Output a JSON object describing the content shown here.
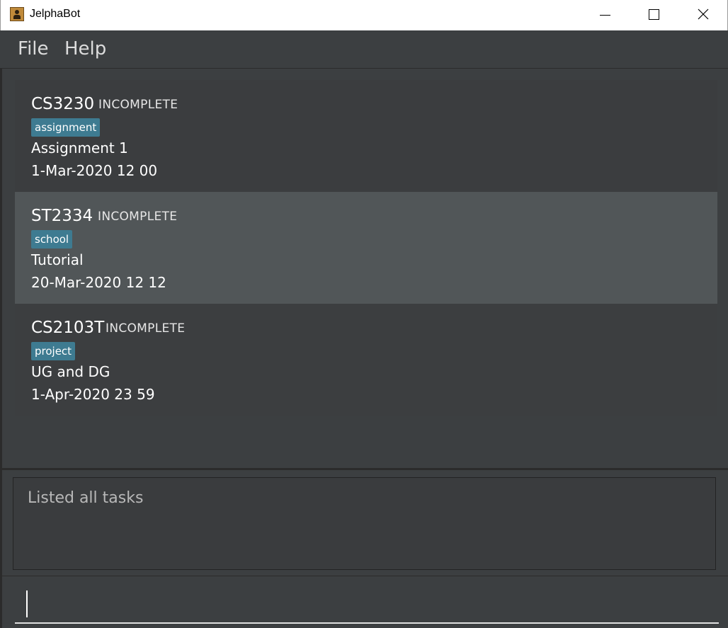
{
  "window": {
    "title": "JelphaBot",
    "controls": [
      "minimize-icon",
      "maximize-icon",
      "close-icon"
    ]
  },
  "menu": {
    "items": [
      {
        "label": "File"
      },
      {
        "label": "Help"
      }
    ]
  },
  "tasks": [
    {
      "module": "CS3230",
      "status": "INCOMPLETE",
      "tag": "assignment",
      "description": "Assignment 1",
      "date": "1-Mar-2020 12 00"
    },
    {
      "module": "ST2334",
      "status": "INCOMPLETE",
      "tag": "school",
      "description": "Tutorial",
      "date": "20-Mar-2020 12 12"
    },
    {
      "module": "CS2103T",
      "status": "INCOMPLETE",
      "tag": "project",
      "description": "UG and DG",
      "date": "1-Apr-2020 23 59"
    }
  ],
  "result": {
    "text": "Listed all tasks"
  },
  "command": {
    "value": ""
  },
  "colors": {
    "background": "#3c3f41",
    "selected_card": "#515658",
    "tag": "#3e7b91"
  }
}
